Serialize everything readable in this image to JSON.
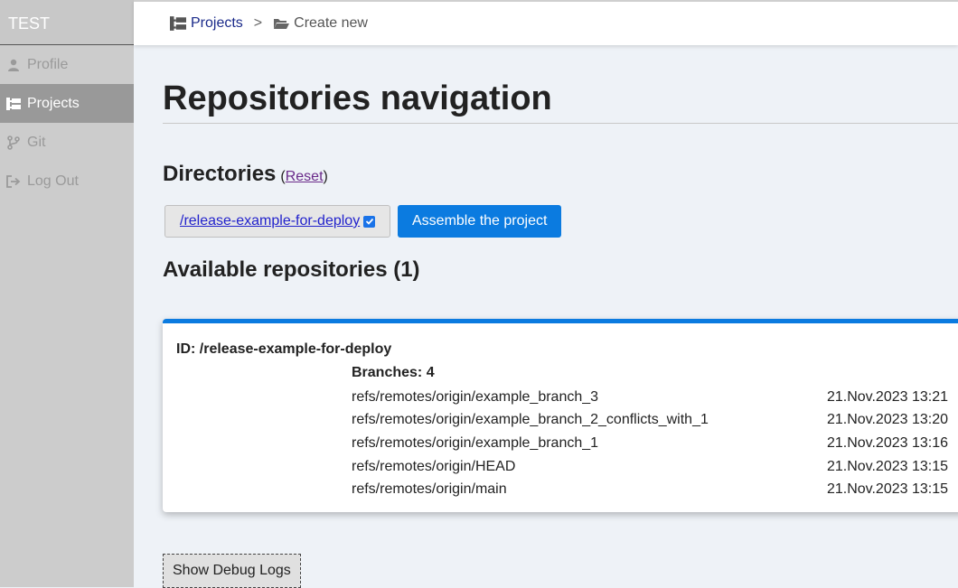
{
  "sidebar": {
    "brand": "TEST",
    "items": [
      {
        "label": "Profile",
        "icon": "user-icon"
      },
      {
        "label": "Projects",
        "icon": "projects-icon",
        "active": true
      },
      {
        "label": "Git",
        "icon": "git-branch-icon"
      },
      {
        "label": "Log Out",
        "icon": "logout-icon"
      }
    ]
  },
  "breadcrumb": {
    "projects": "Projects",
    "separator": ">",
    "current": "Create new"
  },
  "main": {
    "title": "Repositories navigation",
    "directories_title": "Directories",
    "reset_open": "(",
    "reset_label": "Reset",
    "reset_close": ")",
    "directory_link": "/release-example-for-deploy",
    "directory_checked": true,
    "assemble_button": "Assemble the project",
    "available_title": "Available repositories (1)",
    "debug_button": "Show Debug Logs"
  },
  "repository": {
    "id_label": "ID: /release-example-for-deploy",
    "branches_label": "Branches: 4",
    "branches": [
      {
        "name": "refs/remotes/origin/example_branch_3",
        "date": "21.Nov.2023 13:21"
      },
      {
        "name": "refs/remotes/origin/example_branch_2_conflicts_with_1",
        "date": "21.Nov.2023 13:20"
      },
      {
        "name": "refs/remotes/origin/example_branch_1",
        "date": "21.Nov.2023 13:16"
      },
      {
        "name": "refs/remotes/origin/HEAD",
        "date": "21.Nov.2023 13:15"
      },
      {
        "name": "refs/remotes/origin/main",
        "date": "21.Nov.2023 13:15"
      }
    ]
  },
  "colors": {
    "accent": "#0b7be0",
    "sidebar_bg": "#cccccc",
    "sidebar_active": "#999999",
    "page_bg": "#eef2f7"
  }
}
